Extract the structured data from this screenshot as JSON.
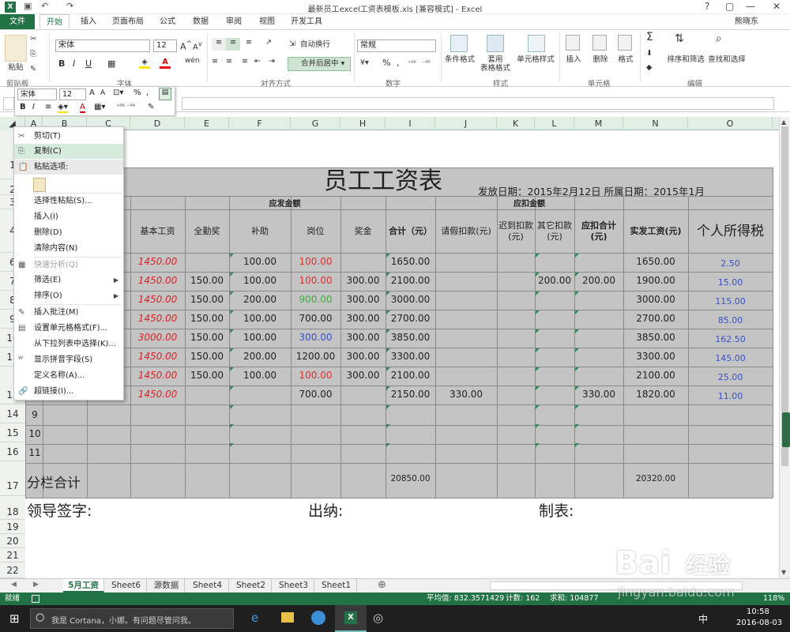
{
  "window": {
    "title": "最新员工excel工资表模板.xls  [兼容模式] - Excel",
    "user": "熊晓东",
    "help": "?",
    "restore": "▢",
    "minimize": "—",
    "close": "✕"
  },
  "qat": {
    "save_icon": "save-icon",
    "undo": "↶",
    "redo": "↷"
  },
  "menu": {
    "file": "文件",
    "tabs": [
      "开始",
      "插入",
      "页面布局",
      "公式",
      "数据",
      "审阅",
      "视图",
      "开发工具"
    ]
  },
  "ribbon": {
    "clipboard": {
      "paste": "粘贴",
      "label": "剪贴板"
    },
    "font": {
      "name": "宋体",
      "size": "12",
      "bold": "B",
      "italic": "I",
      "underline": "U",
      "label": "字体"
    },
    "alignment": {
      "wrap": "自动换行",
      "merge": "合并后居中",
      "label": "对齐方式"
    },
    "number": {
      "format": "常规",
      "percent": "%",
      "comma": ",",
      "label": "数字"
    },
    "styles": {
      "cond": "条件格式",
      "table1": "套用",
      "table2": "表格格式",
      "cell": "单元格样式",
      "label": "样式"
    },
    "cells": {
      "insert": "插入",
      "delete": "删除",
      "format": "格式",
      "label": "单元格"
    },
    "editing": {
      "sigma": "Σ",
      "sort": "排序和筛选",
      "find": "查找和选择",
      "label": "编辑"
    }
  },
  "minibar": {
    "font": "宋体",
    "size": "12",
    "grow": "A",
    "shrink": "A",
    "percent": "%",
    "comma": ",",
    "bold": "B",
    "italic": "I",
    "fontcolor": "A"
  },
  "columns": [
    "A",
    "B",
    "C",
    "D",
    "E",
    "F",
    "G",
    "H",
    "I",
    "J",
    "K",
    "L",
    "M",
    "N",
    "O"
  ],
  "rows": [
    "1",
    "2",
    "3",
    "4",
    "6",
    "7",
    "8",
    "9",
    "10",
    "11",
    "13",
    "14",
    "15",
    "16",
    "17",
    "18",
    "19",
    "20",
    "21",
    "22"
  ],
  "sheet": {
    "title": "员工工资表",
    "date": "发放日期：2015年2月12日 所属日期：2015年1月",
    "yingfa": "应发金额",
    "yingkou": "应扣金额",
    "headers": [
      "基本工资",
      "全勤奖",
      "补助",
      "岗位",
      "奖金",
      "合计（元）",
      "请假扣款(元)",
      "迟到扣款(元)",
      "其它扣款(元)",
      "应扣合计(元)",
      "实发工资(元)",
      "个人所得税"
    ],
    "rows": [
      [
        "1450.00",
        "",
        "100.00",
        "100.00",
        "",
        "1650.00",
        "",
        "",
        "",
        "",
        "1650.00",
        "2.50"
      ],
      [
        "1450.00",
        "150.00",
        "100.00",
        "100.00",
        "300.00",
        "2100.00",
        "",
        "",
        "200.00",
        "200.00",
        "1900.00",
        "15.00"
      ],
      [
        "1450.00",
        "150.00",
        "200.00",
        "900.00",
        "300.00",
        "3000.00",
        "",
        "",
        "",
        "",
        "3000.00",
        "115.00"
      ],
      [
        "1450.00",
        "150.00",
        "100.00",
        "700.00",
        "300.00",
        "2700.00",
        "",
        "",
        "",
        "",
        "2700.00",
        "85.00"
      ],
      [
        "3000.00",
        "150.00",
        "100.00",
        "300.00",
        "300.00",
        "3850.00",
        "",
        "",
        "",
        "",
        "3850.00",
        "162.50"
      ],
      [
        "1450.00",
        "150.00",
        "200.00",
        "1200.00",
        "300.00",
        "3300.00",
        "",
        "",
        "",
        "",
        "3300.00",
        "145.00"
      ],
      [
        "1450.00",
        "150.00",
        "100.00",
        "100.00",
        "300.00",
        "2100.00",
        "",
        "",
        "",
        "",
        "2100.00",
        "25.00"
      ],
      [
        "1450.00",
        "",
        "",
        "700.00",
        "",
        "2150.00",
        "330.00",
        "",
        "",
        "330.00",
        "1820.00",
        "11.00"
      ]
    ],
    "nums": [
      "9",
      "10",
      "11"
    ],
    "subtotal_label": "分栏合计",
    "subtotal_total": "20850.00",
    "subtotal_net": "20320.00",
    "sign_leader": "领导签字:",
    "sign_cashier": "出纳:",
    "sign_maker": "制表:"
  },
  "context_menu": [
    {
      "label": "剪切(T)",
      "icon": "✂",
      "state": "normal"
    },
    {
      "label": "复制(C)",
      "icon": "⎘",
      "state": "hl"
    },
    {
      "label": "粘贴选项:",
      "icon": "📋",
      "state": "header"
    },
    {
      "label": "选择性粘贴(S)...",
      "icon": "",
      "state": "normal"
    },
    {
      "label": "插入(I)",
      "icon": "",
      "state": "normal"
    },
    {
      "label": "删除(D)",
      "icon": "",
      "state": "normal"
    },
    {
      "label": "清除内容(N)",
      "icon": "",
      "state": "normal"
    },
    {
      "label": "快速分析(Q)",
      "icon": "▦",
      "state": "dis"
    },
    {
      "label": "筛选(E)",
      "icon": "",
      "state": "sub"
    },
    {
      "label": "排序(O)",
      "icon": "",
      "state": "sub"
    },
    {
      "label": "插入批注(M)",
      "icon": "✎",
      "state": "normal"
    },
    {
      "label": "设置单元格格式(F)...",
      "icon": "▤",
      "state": "normal"
    },
    {
      "label": "从下拉列表中选择(K)...",
      "icon": "",
      "state": "normal"
    },
    {
      "label": "显示拼音字段(S)",
      "icon": "ᵂ",
      "state": "normal"
    },
    {
      "label": "定义名称(A)...",
      "icon": "",
      "state": "normal"
    },
    {
      "label": "超链接(I)...",
      "icon": "🔗",
      "state": "normal"
    }
  ],
  "sheet_tabs": [
    "5月工资",
    "Sheet6",
    "源数据",
    "Sheet4",
    "Sheet2",
    "Sheet3",
    "Sheet1"
  ],
  "status": {
    "ready": "就绪",
    "average": "平均值: 832.3571429",
    "count": "计数: 162",
    "sum": "求和: 104877",
    "zoom": "118%"
  },
  "taskbar": {
    "search": "我是 Cortana，小娜。有问题尽管问我。",
    "time": "10:58",
    "date": "2016-08-03",
    "ime": "中"
  },
  "watermark": {
    "brand": "Bai",
    "brand2": "经验",
    "url": "jingyan.baidu.com"
  },
  "colors": {
    "excel_green": "#217346",
    "sheet_gray": "#c4c4c4",
    "header_green": "#e2efe6"
  }
}
